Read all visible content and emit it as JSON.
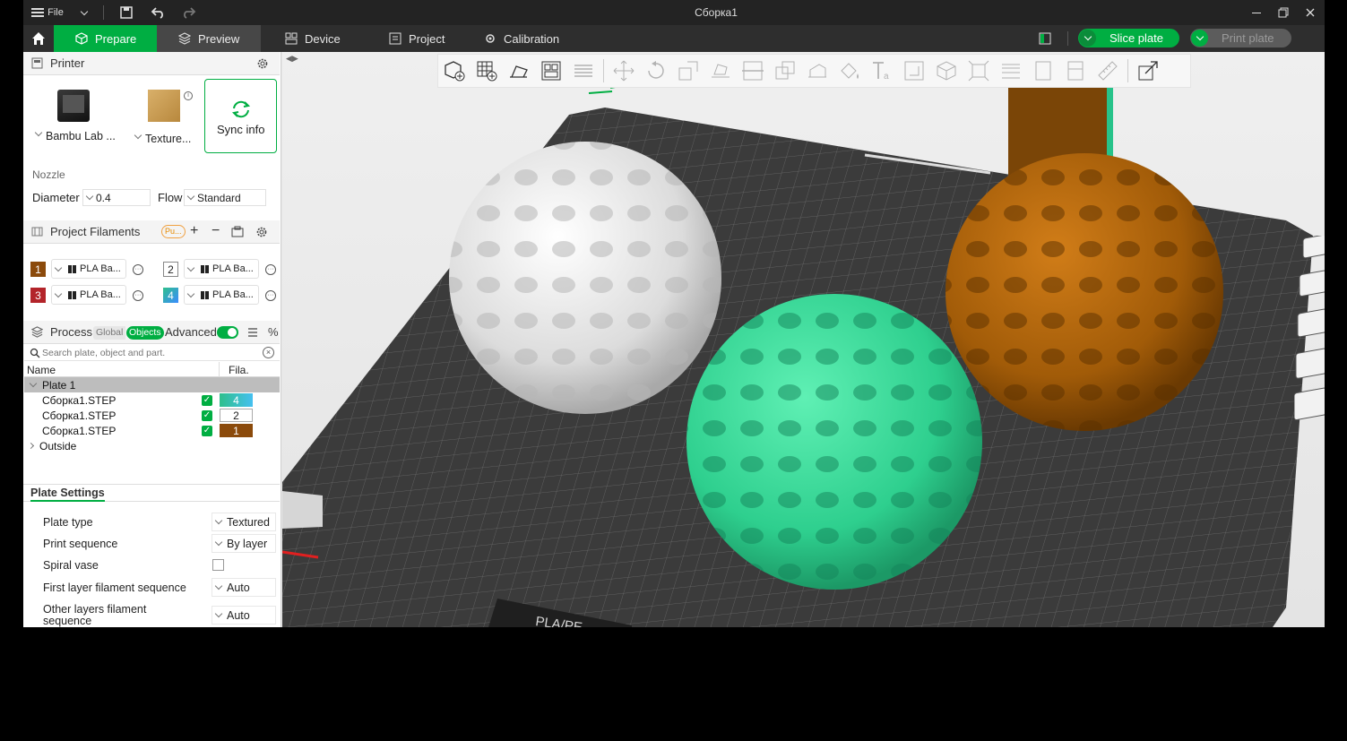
{
  "titlebar": {
    "file_label": "File",
    "title": "Сборка1"
  },
  "nav": {
    "tabs": [
      {
        "label": "Prepare"
      },
      {
        "label": "Preview"
      },
      {
        "label": "Device"
      },
      {
        "label": "Project"
      },
      {
        "label": "Calibration"
      }
    ],
    "slice_label": "Slice plate",
    "print_label": "Print plate"
  },
  "printer": {
    "section_title": "Printer",
    "printer_name": "Bambu Lab ...",
    "plate_name": "Texture...",
    "sync_label": "Sync info",
    "nozzle_label": "Nozzle",
    "diameter_label": "Diameter",
    "diameter_value": "0.4",
    "flow_label": "Flow",
    "flow_value": "Standard"
  },
  "filaments": {
    "section_title": "Project Filaments",
    "badge": "Pu...",
    "items": [
      {
        "num": "1",
        "name": "PLA Ba...",
        "color": "#8b4a0b"
      },
      {
        "num": "2",
        "name": "PLA Ba...",
        "color": "#ffffff"
      },
      {
        "num": "3",
        "name": "PLA Ba...",
        "color": "#b3242a"
      },
      {
        "num": "4",
        "name": "PLA Ba...",
        "color": "#2fbf8c"
      }
    ]
  },
  "process": {
    "section_title": "Process",
    "global_label": "Global",
    "objects_label": "Objects",
    "advanced_label": "Advanced",
    "search_placeholder": "Search plate, object and part.",
    "col_name": "Name",
    "col_fila": "Fila.",
    "plate_label": "Plate 1",
    "objects": [
      {
        "name": "Сборка1.STEP",
        "fila": "4",
        "fila_color": "#3ccf9a"
      },
      {
        "name": "Сборка1.STEP",
        "fila": "2",
        "fila_color": "#ffffff"
      },
      {
        "name": "Сборка1.STEP",
        "fila": "1",
        "fila_color": "#8b4a0b"
      }
    ],
    "outside_label": "Outside"
  },
  "plate_settings": {
    "title": "Plate Settings",
    "rows": [
      {
        "label": "Plate type",
        "value": "Textured"
      },
      {
        "label": "Print sequence",
        "value": "By layer"
      },
      {
        "label": "Spiral vase",
        "value": ""
      },
      {
        "label": "First layer filament sequence",
        "value": "Auto"
      },
      {
        "label": "Other layers filament sequence",
        "value": "Auto"
      }
    ]
  },
  "viewport": {
    "plate_text": "PLA/PE",
    "sphere_colors": {
      "white": "#e8e8e8",
      "green": "#2ecf8e",
      "brown": "#a15b08"
    }
  },
  "colors": {
    "accent": "#00ae42",
    "titlebar": "#232323",
    "navbar": "#2e2e2e"
  }
}
